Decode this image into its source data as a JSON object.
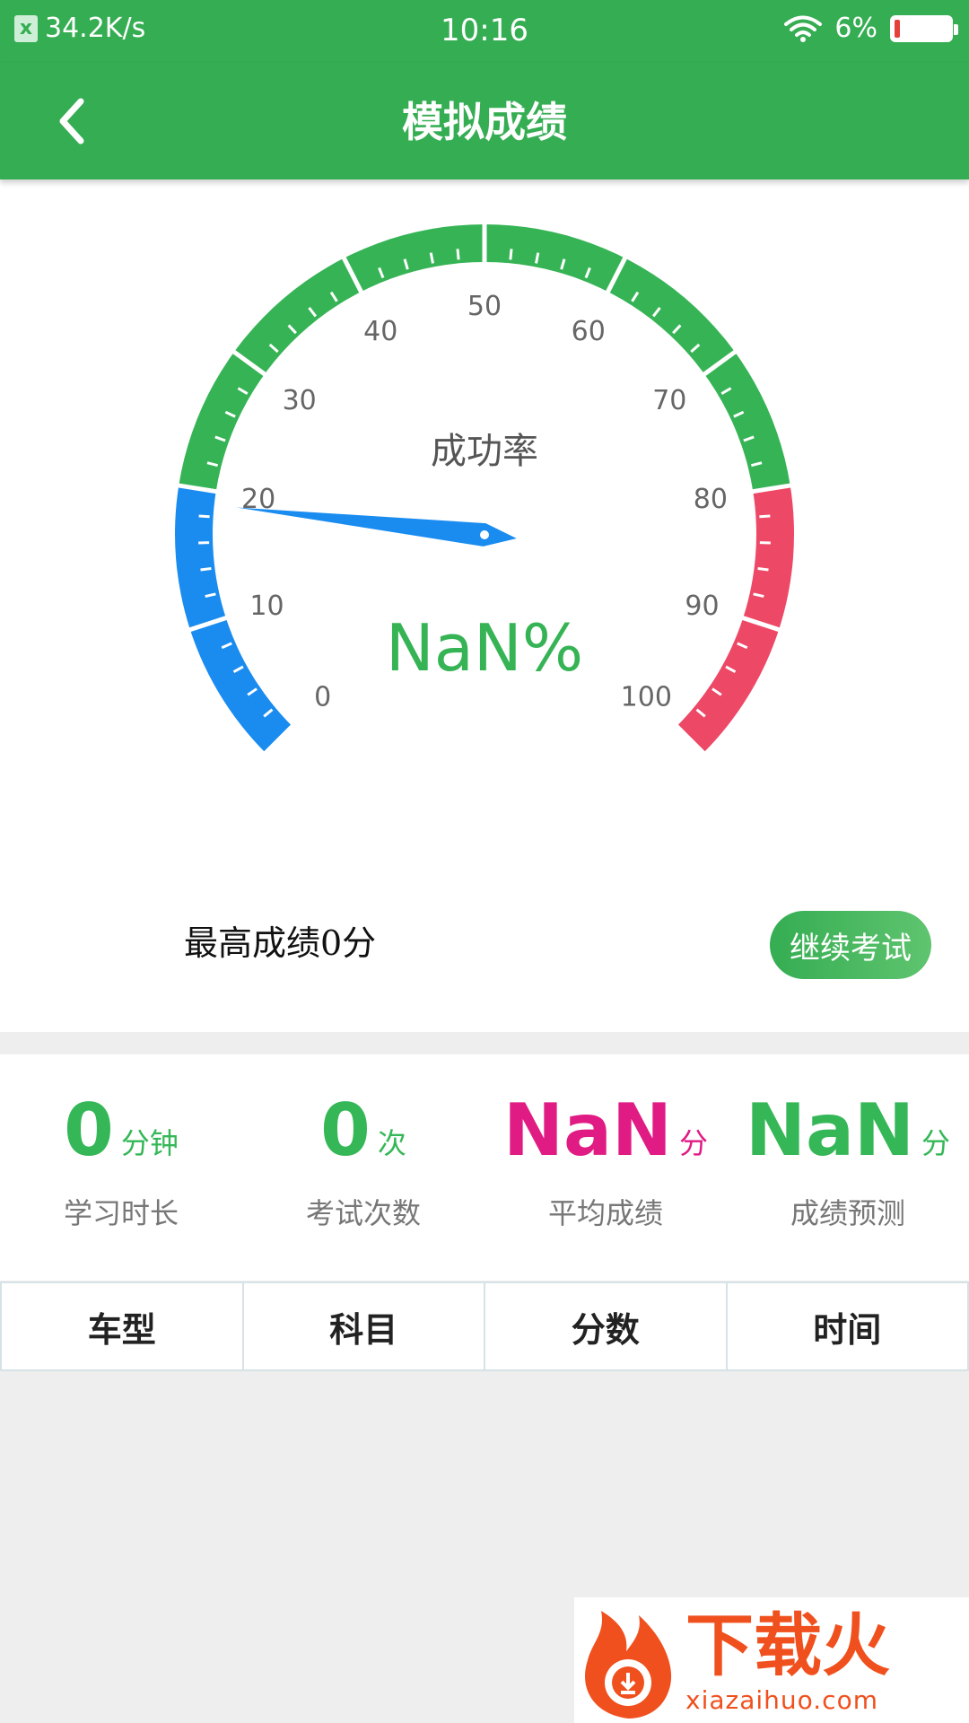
{
  "status_bar": {
    "net_speed": "34.2K/s",
    "net_icon_label": "x",
    "time": "10:16",
    "battery_percent": "6%",
    "battery_level": 0.06
  },
  "app_bar": {
    "title": "模拟成绩",
    "back_icon": "chevron-left-icon"
  },
  "gauge": {
    "center_label": "成功率",
    "value_text": "NaN%",
    "needle_value": 19,
    "min": 0,
    "max": 100,
    "tick_labels": [
      "0",
      "10",
      "20",
      "30",
      "40",
      "50",
      "60",
      "70",
      "80",
      "90",
      "100"
    ],
    "zones": [
      {
        "from": 0,
        "to": 20,
        "color": "#1a8cf0"
      },
      {
        "from": 20,
        "to": 80,
        "color": "#36b455"
      },
      {
        "from": 80,
        "to": 100,
        "color": "#ed4866"
      }
    ],
    "needle_color": "#1a8cf0",
    "value_color": "#36b455"
  },
  "best_score": "最高成绩0分",
  "continue_button": "继续考试",
  "stats": [
    {
      "value": "0",
      "unit": "分钟",
      "label": "学习时长",
      "color": "green"
    },
    {
      "value": "0",
      "unit": "次",
      "label": "考试次数",
      "color": "green"
    },
    {
      "value": "NaN",
      "unit": "分",
      "label": "平均成绩",
      "color": "pink"
    },
    {
      "value": "NaN",
      "unit": "分",
      "label": "成绩预测",
      "color": "green"
    }
  ],
  "table": {
    "headers": [
      "车型",
      "科目",
      "分数",
      "时间"
    ]
  },
  "watermark": {
    "main": "下载火",
    "sub": "xiazaihuo.com"
  }
}
